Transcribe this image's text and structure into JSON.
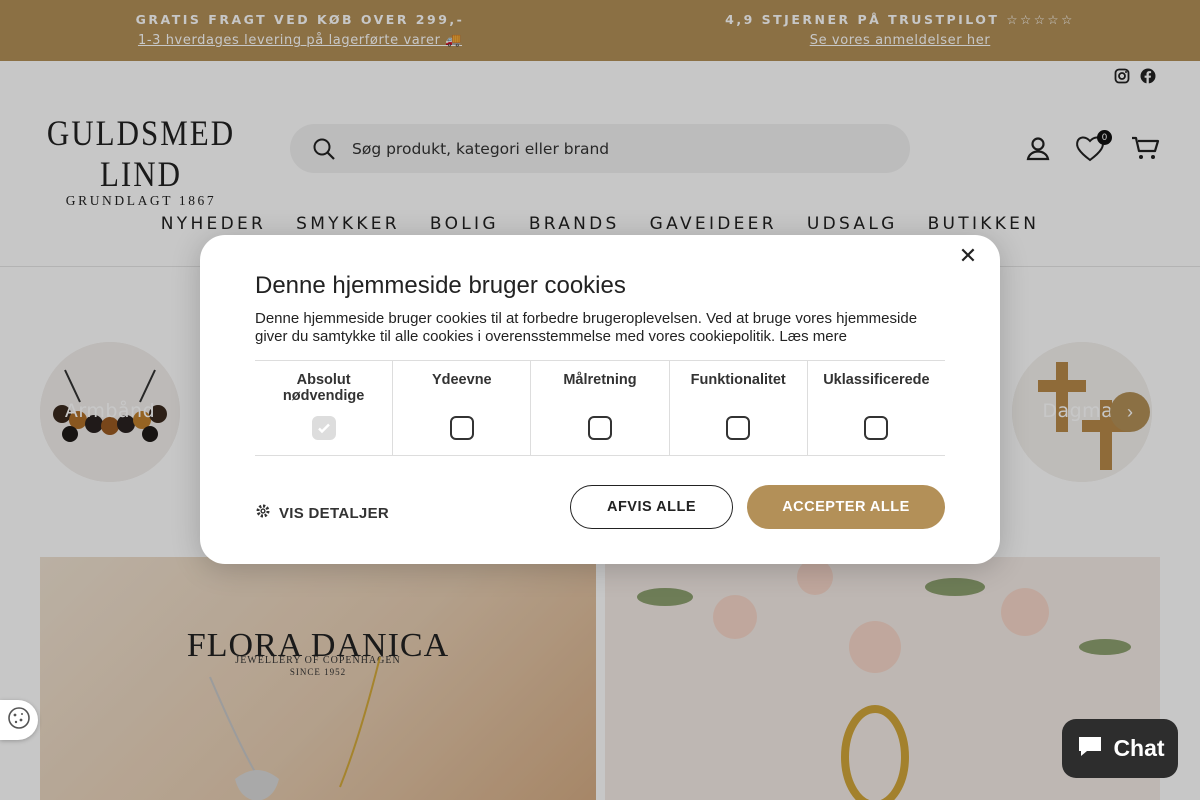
{
  "announcement": {
    "left_title": "GRATIS FRAGT VED KØB OVER 299,-",
    "left_link": "1-3 hverdages levering på lagerførte varer 🚚",
    "right_title": "4,9 STJERNER PÅ TRUSTPILOT ☆☆☆☆☆",
    "right_link": "Se vores anmeldelser her"
  },
  "logo": {
    "name": "GULDSMED LIND",
    "tagline": "GRUNDLAGT 1867"
  },
  "search": {
    "placeholder": "Søg produkt, kategori eller brand"
  },
  "header": {
    "wishlist_count": "0"
  },
  "nav": [
    "NYHEDER",
    "SMYKKER",
    "BOLIG",
    "BRANDS",
    "GAVEIDEER",
    "UDSALG",
    "BUTIKKEN"
  ],
  "categories": [
    {
      "label": "Armbånd"
    },
    {
      "label": "Dagmar"
    }
  ],
  "banners": {
    "left_brand": "FLORA DANICA",
    "left_sub": "JEWELLERY OF COPENHAGEN",
    "left_since": "SINCE 1952"
  },
  "cookie_modal": {
    "title": "Denne hjemmeside bruger cookies",
    "text": "Denne hjemmeside bruger cookies til at forbedre brugeroplevelsen. Ved at bruge vores hjemmeside giver du samtykke til alle cookies i overensstemmelse med vores cookiepolitik.",
    "learn_more": "Læs mere",
    "options": [
      {
        "label": "Absolut nødvendige",
        "checked": true,
        "disabled": true
      },
      {
        "label": "Ydeevne",
        "checked": false
      },
      {
        "label": "Målretning",
        "checked": false
      },
      {
        "label": "Funktionalitet",
        "checked": false
      },
      {
        "label": "Uklassificerede",
        "checked": false
      }
    ],
    "details": "VIS DETALJER",
    "reject": "AFVIS ALLE",
    "accept": "ACCEPTER ALLE"
  },
  "chat": {
    "label": "Chat"
  },
  "colors": {
    "brand": "#b39058",
    "dark": "#2d2d2d"
  }
}
